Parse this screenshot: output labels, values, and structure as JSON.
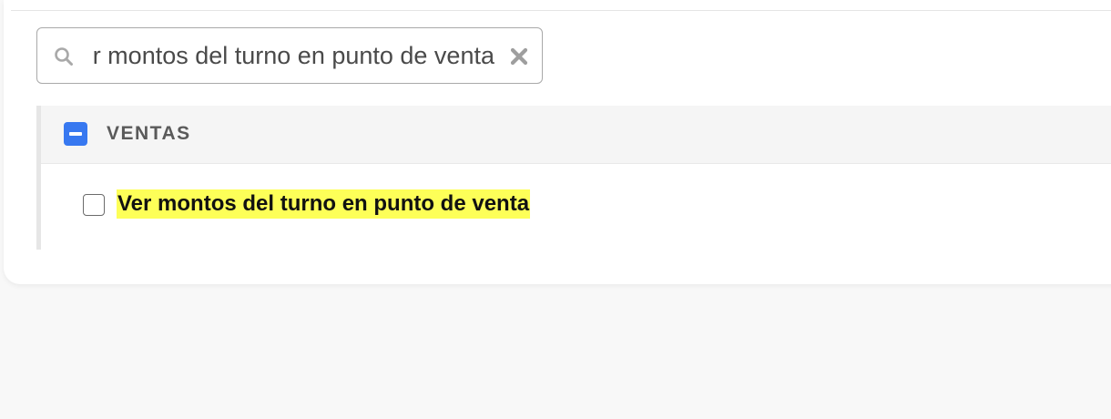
{
  "search": {
    "value": "Ver montos del turno en punto de venta",
    "icon": "search-icon",
    "clear_icon": "close-icon"
  },
  "permission_group": {
    "title": "VENTAS",
    "checkbox_state": "indeterminate",
    "accent_color": "#3778f0",
    "items": [
      {
        "label": "Ver montos del turno en punto de venta",
        "checked": false,
        "highlight_color": "#fdff58"
      }
    ]
  }
}
